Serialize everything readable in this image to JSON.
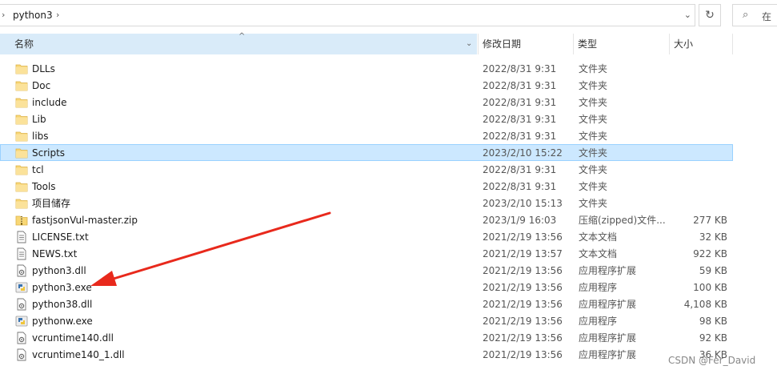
{
  "address_bar": {
    "path": "python3",
    "search_placeholder": "在"
  },
  "columns": {
    "name": "名称",
    "date": "修改日期",
    "type": "类型",
    "size": "大小"
  },
  "files": [
    {
      "name": "DLLs",
      "date": "2022/8/31 9:31",
      "type": "文件夹",
      "size": "",
      "icon": "folder-icon",
      "selected": false
    },
    {
      "name": "Doc",
      "date": "2022/8/31 9:31",
      "type": "文件夹",
      "size": "",
      "icon": "folder-icon",
      "selected": false
    },
    {
      "name": "include",
      "date": "2022/8/31 9:31",
      "type": "文件夹",
      "size": "",
      "icon": "folder-icon",
      "selected": false
    },
    {
      "name": "Lib",
      "date": "2022/8/31 9:31",
      "type": "文件夹",
      "size": "",
      "icon": "folder-icon",
      "selected": false
    },
    {
      "name": "libs",
      "date": "2022/8/31 9:31",
      "type": "文件夹",
      "size": "",
      "icon": "folder-icon",
      "selected": false
    },
    {
      "name": "Scripts",
      "date": "2023/2/10 15:22",
      "type": "文件夹",
      "size": "",
      "icon": "folder-icon",
      "selected": true
    },
    {
      "name": "tcl",
      "date": "2022/8/31 9:31",
      "type": "文件夹",
      "size": "",
      "icon": "folder-icon",
      "selected": false
    },
    {
      "name": "Tools",
      "date": "2022/8/31 9:31",
      "type": "文件夹",
      "size": "",
      "icon": "folder-icon",
      "selected": false
    },
    {
      "name": "项目储存",
      "date": "2023/2/10 15:13",
      "type": "文件夹",
      "size": "",
      "icon": "folder-icon",
      "selected": false
    },
    {
      "name": "fastjsonVul-master.zip",
      "date": "2023/1/9 16:03",
      "type": "压缩(zipped)文件...",
      "size": "277 KB",
      "icon": "zip-icon",
      "selected": false
    },
    {
      "name": "LICENSE.txt",
      "date": "2021/2/19 13:56",
      "type": "文本文档",
      "size": "32 KB",
      "icon": "text-file-icon",
      "selected": false
    },
    {
      "name": "NEWS.txt",
      "date": "2021/2/19 13:57",
      "type": "文本文档",
      "size": "922 KB",
      "icon": "text-file-icon",
      "selected": false
    },
    {
      "name": "python3.dll",
      "date": "2021/2/19 13:56",
      "type": "应用程序扩展",
      "size": "59 KB",
      "icon": "dll-icon",
      "selected": false
    },
    {
      "name": "python3.exe",
      "date": "2021/2/19 13:56",
      "type": "应用程序",
      "size": "100 KB",
      "icon": "python-exe-icon",
      "selected": false
    },
    {
      "name": "python38.dll",
      "date": "2021/2/19 13:56",
      "type": "应用程序扩展",
      "size": "4,108 KB",
      "icon": "dll-icon",
      "selected": false
    },
    {
      "name": "pythonw.exe",
      "date": "2021/2/19 13:56",
      "type": "应用程序",
      "size": "98 KB",
      "icon": "python-exe-icon",
      "selected": false
    },
    {
      "name": "vcruntime140.dll",
      "date": "2021/2/19 13:56",
      "type": "应用程序扩展",
      "size": "92 KB",
      "icon": "dll-icon",
      "selected": false
    },
    {
      "name": "vcruntime140_1.dll",
      "date": "2021/2/19 13:56",
      "type": "应用程序扩展",
      "size": "36 KB",
      "icon": "dll-icon",
      "selected": false
    }
  ],
  "watermark": "CSDN @Fer_David",
  "colors": {
    "header_sort_bg": "#d9ebf9",
    "selection_bg": "#cce8ff",
    "selection_border": "#99d1ff",
    "folder": "#f8d775",
    "annotation_arrow": "#e8291c"
  }
}
